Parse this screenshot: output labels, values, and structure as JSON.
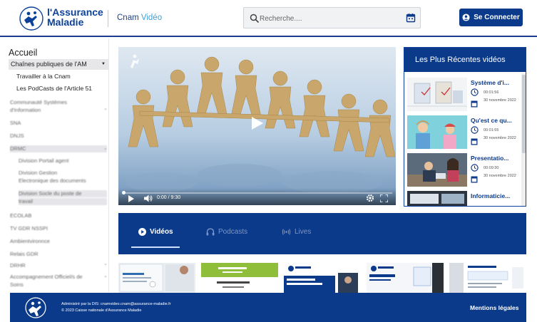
{
  "header": {
    "logo_line1": "l'Assurance",
    "logo_line2": "Maladie",
    "sub_prefix": "Cnam",
    "sub_accent": "Vidéo",
    "search_placeholder": "Recherche....",
    "login_label": "Se Connecter"
  },
  "sidebar": {
    "title": "Accueil",
    "selected": "Chaînes publiques de l'AM",
    "items": [
      "Travailler à la Cnam",
      "Les PodCasts de l'Article 51"
    ],
    "blurred_items": [
      "Communauté Systèmes",
      "d'Information",
      "SNA",
      "DNJS",
      "DRMC",
      "Division Portail agent",
      "Division Gestion",
      "Electronique des documents",
      "Division Socle du poste de",
      "travail",
      "ECOLAB",
      "TV GDR NSSPI",
      "Ambientvironnce",
      "Relais GDR",
      "DRHR",
      "Accompagnement Officiel/s de",
      "Soins"
    ]
  },
  "player": {
    "time_current": "0:00",
    "time_separator": "/",
    "time_total": "9:30",
    "progress_fraction": 0.0
  },
  "recent": {
    "title": "Les Plus Récentes vidéos",
    "items": [
      {
        "title": "Système d'i...",
        "duration": "00:01:56",
        "date": "30 novembre 2022"
      },
      {
        "title": "Qu'est ce qu...",
        "duration": "00:01:55",
        "date": "30 novembre 2022"
      },
      {
        "title": "Presentatio...",
        "duration": "00:09:30",
        "date": "30 novembre 2022"
      },
      {
        "title": "Informaticie...",
        "duration": "",
        "date": ""
      }
    ]
  },
  "tabs": {
    "videos": "Vidéos",
    "podcasts": "Podcasts",
    "lives": "Lives"
  },
  "footer": {
    "admin": "Administré par la DIS: cnamvideo.cnam@assurance-maladie.fr",
    "copyright": "© 2023 Caisse nationale d'Assurance Maladie",
    "legal": "Mentions légales"
  },
  "colors": {
    "brand": "#0c3a8a",
    "accent": "#3aa0d8"
  }
}
